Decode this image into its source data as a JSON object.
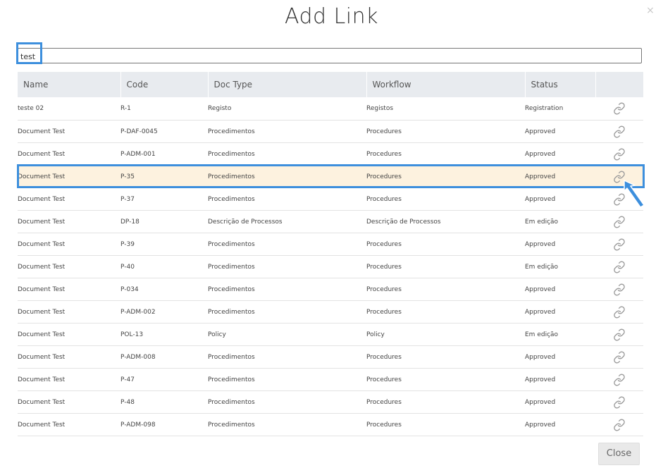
{
  "dialog": {
    "title": "Add Link",
    "close_icon": "×",
    "close_button_label": "Close"
  },
  "search": {
    "value": "test",
    "placeholder": ""
  },
  "table": {
    "columns": [
      "Name",
      "Code",
      "Doc Type",
      "Workflow",
      "Status"
    ],
    "rows": [
      {
        "name": "teste 02",
        "code": "R-1",
        "doc_type": "Registo",
        "workflow": "Registos",
        "status": "Registration"
      },
      {
        "name": "Document Test",
        "code": "P-DAF-0045",
        "doc_type": "Procedimentos",
        "workflow": "Procedures",
        "status": "Approved"
      },
      {
        "name": "Document Test",
        "code": "P-ADM-001",
        "doc_type": "Procedimentos",
        "workflow": "Procedures",
        "status": "Approved"
      },
      {
        "name": "Document Test",
        "code": "P-35",
        "doc_type": "Procedimentos",
        "workflow": "Procedures",
        "status": "Approved"
      },
      {
        "name": "Document Test",
        "code": "P-37",
        "doc_type": "Procedimentos",
        "workflow": "Procedures",
        "status": "Approved"
      },
      {
        "name": "Document Test",
        "code": "DP-18",
        "doc_type": "Descrição de Processos",
        "workflow": "Descrição de Processos",
        "status": "Em edição"
      },
      {
        "name": "Document Test",
        "code": "P-39",
        "doc_type": "Procedimentos",
        "workflow": "Procedures",
        "status": "Approved"
      },
      {
        "name": "Document Test",
        "code": "P-40",
        "doc_type": "Procedimentos",
        "workflow": "Procedures",
        "status": "Em edição"
      },
      {
        "name": "Document Test",
        "code": "P-034",
        "doc_type": "Procedimentos",
        "workflow": "Procedures",
        "status": "Approved"
      },
      {
        "name": "Document Test",
        "code": "P-ADM-002",
        "doc_type": "Procedimentos",
        "workflow": "Procedures",
        "status": "Approved"
      },
      {
        "name": "Document Test",
        "code": "POL-13",
        "doc_type": "Policy",
        "workflow": "Policy",
        "status": "Em edição"
      },
      {
        "name": "Document Test",
        "code": "P-ADM-008",
        "doc_type": "Procedimentos",
        "workflow": "Procedures",
        "status": "Approved"
      },
      {
        "name": "Document Test",
        "code": "P-47",
        "doc_type": "Procedimentos",
        "workflow": "Procedures",
        "status": "Approved"
      },
      {
        "name": "Document Test",
        "code": "P-48",
        "doc_type": "Procedimentos",
        "workflow": "Procedures",
        "status": "Approved"
      },
      {
        "name": "Document Test",
        "code": "P-ADM-098",
        "doc_type": "Procedimentos",
        "workflow": "Procedures",
        "status": "Approved"
      }
    ],
    "highlighted_row_index": 3,
    "row_action_icon": "link-icon"
  },
  "colors": {
    "highlight_border": "#3d8fdd",
    "highlight_row_bg": "#fdf2df",
    "header_bg": "#e8ebef",
    "link_icon": "#9a9a9a"
  }
}
